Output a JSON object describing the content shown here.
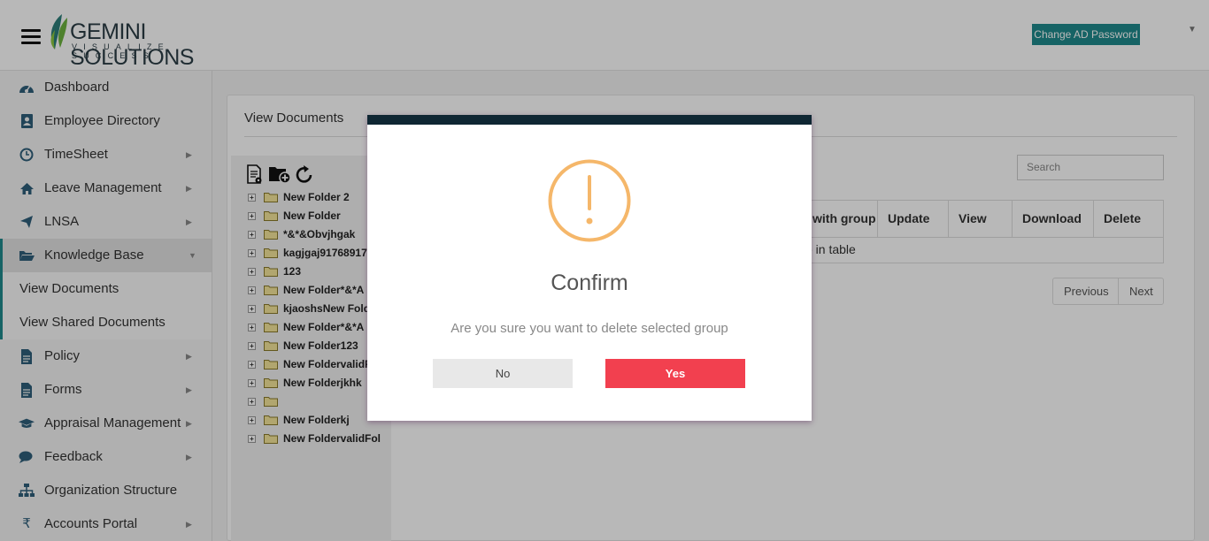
{
  "header": {
    "logo_text": "GEMINI SOLUTIONS",
    "logo_tagline": "VISUALIZE SUCCESS",
    "change_password_label": "Change AD Password"
  },
  "sidebar": {
    "items": [
      {
        "label": "Dashboard",
        "icon": "dashboard-icon"
      },
      {
        "label": "Employee Directory",
        "icon": "address-book-icon"
      },
      {
        "label": "TimeSheet",
        "icon": "clock-icon"
      },
      {
        "label": "Leave Management",
        "icon": "home-icon"
      },
      {
        "label": "LNSA",
        "icon": "send-icon"
      },
      {
        "label": "Knowledge Base",
        "icon": "folder-open-icon"
      },
      {
        "label": "Policy",
        "icon": "file-icon"
      },
      {
        "label": "Forms",
        "icon": "file-text-icon"
      },
      {
        "label": "Appraisal Management",
        "icon": "graduation-cap-icon"
      },
      {
        "label": "Feedback",
        "icon": "comments-icon"
      },
      {
        "label": "Organization Structure",
        "icon": "sitemap-icon"
      },
      {
        "label": "Accounts Portal",
        "icon": "rupee-icon"
      }
    ],
    "sub_items": [
      {
        "label": "View Documents"
      },
      {
        "label": "View Shared Documents"
      }
    ]
  },
  "main": {
    "title": "View Documents",
    "search_placeholder": "Search",
    "tree_items": [
      "New Folder 2",
      "New Folder",
      "*&*&Obvjhgak",
      "kagjgaj91768917",
      "123",
      "New Folder*&*A",
      "kjaoshsNew Folde",
      "New Folder*&*A",
      "New Folder123",
      "New FoldervalidF",
      "New Folderjkhk",
      "",
      "New Folderkj",
      "New FoldervalidFol"
    ],
    "table": {
      "headers": [
        "with group",
        "Update",
        "View",
        "Download",
        "Delete"
      ],
      "empty_text": "e in table"
    },
    "pager": {
      "previous": "Previous",
      "next": "Next"
    }
  },
  "modal": {
    "title": "Confirm",
    "message": "Are you sure you want to delete selected group",
    "no_label": "No",
    "yes_label": "Yes",
    "icon": "exclamation-circle-icon",
    "colors": {
      "warning": "#f5b76a",
      "yes": "#f2404f",
      "bar": "#0f2733"
    }
  }
}
